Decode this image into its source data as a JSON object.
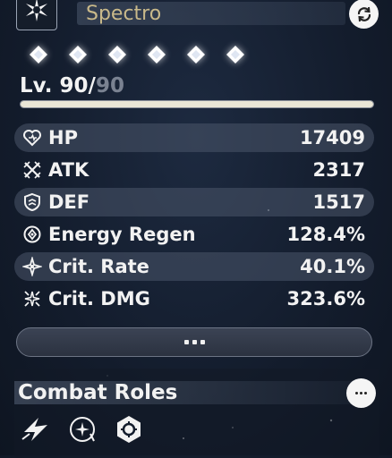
{
  "header": {
    "element_name": "Spectro",
    "element_icon": "spectro-star-icon",
    "refresh_icon": "refresh-icon"
  },
  "sequence": {
    "nodes": [
      {
        "icon": "diamond-icon"
      },
      {
        "icon": "diamond-icon"
      },
      {
        "icon": "diamond-icon"
      },
      {
        "icon": "diamond-icon"
      },
      {
        "icon": "diamond-icon"
      },
      {
        "icon": "diamond-icon"
      }
    ]
  },
  "level": {
    "prefix": "Lv. ",
    "current": "90",
    "separator": "/",
    "max": "90",
    "progress": 1.0
  },
  "stats": [
    {
      "icon": "heart-icon",
      "label": "HP",
      "value": "17409"
    },
    {
      "icon": "swords-icon",
      "label": "ATK",
      "value": "2317"
    },
    {
      "icon": "shield-icon",
      "label": "DEF",
      "value": "1517"
    },
    {
      "icon": "energy-icon",
      "label": "Energy Regen",
      "value": "128.4%"
    },
    {
      "icon": "crit-rate-icon",
      "label": "Crit. Rate",
      "value": "40.1%"
    },
    {
      "icon": "crit-dmg-icon",
      "label": "Crit. DMG",
      "value": "323.6%"
    }
  ],
  "more_button": {
    "icon": "more-dots-icon"
  },
  "combat_roles": {
    "title": "Combat Roles",
    "more_icon": "ellipsis-icon",
    "roles": [
      {
        "icon": "lightning-slash-icon"
      },
      {
        "icon": "star-burst-icon"
      },
      {
        "icon": "hexagon-gear-icon"
      }
    ]
  },
  "colors": {
    "background": "#131c2c",
    "element_text": "#c9b98a",
    "text": "#f2f2f2",
    "muted": "#7a8291"
  }
}
